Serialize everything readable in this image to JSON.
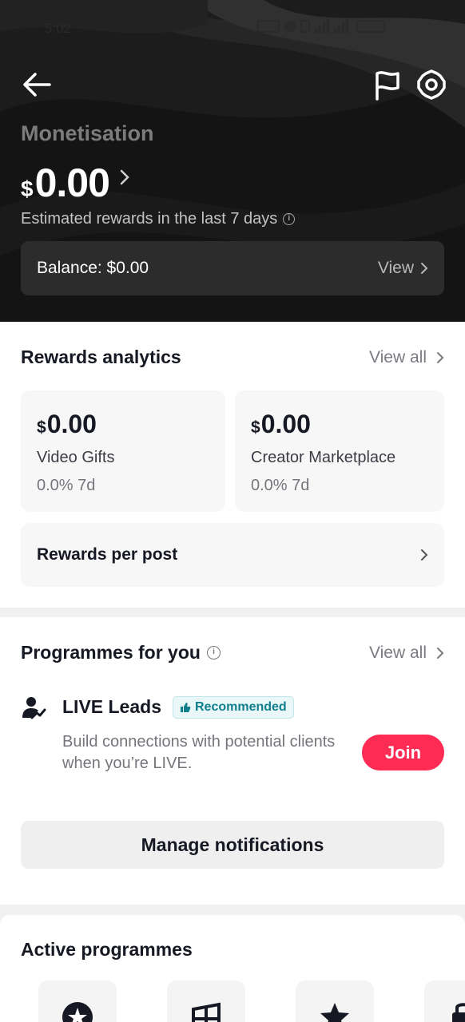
{
  "status_bar": {
    "time": "5:02"
  },
  "header": {
    "title": "Monetisation",
    "currency_symbol": "$",
    "amount": "0.00",
    "subtitle": "Estimated rewards in the last 7 days",
    "balance_label": "Balance: $0.00",
    "view_label": "View"
  },
  "rewards": {
    "title": "Rewards analytics",
    "view_all": "View all",
    "cards": [
      {
        "currency": "$",
        "value": "0.00",
        "label": "Video Gifts",
        "change": "0.0% 7d"
      },
      {
        "currency": "$",
        "value": "0.00",
        "label": "Creator Marketplace",
        "change": "0.0% 7d"
      }
    ],
    "per_post": "Rewards per post"
  },
  "programmes": {
    "title": "Programmes for you",
    "view_all": "View all",
    "item": {
      "name": "LIVE Leads",
      "badge": "Recommended",
      "description": "Build connections with potential clients when you’re LIVE.",
      "action": "Join"
    },
    "manage": "Manage notifications"
  },
  "active": {
    "title": "Active programmes"
  },
  "colors": {
    "accent": "#fe2c55",
    "badge": "#0f7f8d",
    "hero_bg": "#121212"
  },
  "icons": [
    "back-arrow-icon",
    "flag-icon",
    "gear-icon",
    "chevron-right-icon",
    "info-icon",
    "person-growth-icon",
    "thumbs-up-icon",
    "star-icon",
    "grid-icon"
  ]
}
